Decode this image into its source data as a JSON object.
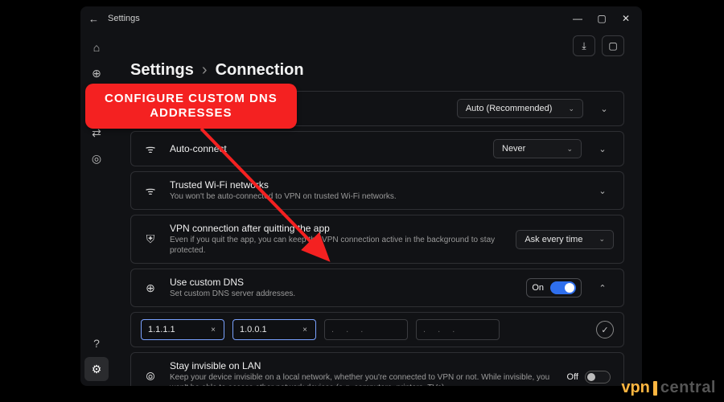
{
  "annotation": {
    "text_line1": "CONFIGURE CUSTOM DNS",
    "text_line2": "ADDRESSES",
    "color": "#f42121"
  },
  "window": {
    "back_label": "Settings",
    "winctrls": {
      "min": "—",
      "max": "▢",
      "close": "✕"
    }
  },
  "sidebar": {
    "items": [
      {
        "name": "home-icon",
        "glyph": "⌂"
      },
      {
        "name": "globe-icon",
        "glyph": "⊕"
      },
      {
        "name": "shuffle-icon",
        "glyph": "⇄"
      },
      {
        "name": "target-icon",
        "glyph": "◎"
      }
    ],
    "bottom": [
      {
        "name": "help-icon",
        "glyph": "?"
      },
      {
        "name": "gear-icon",
        "glyph": "⚙",
        "active": true
      }
    ]
  },
  "topactions": {
    "download": "⤓",
    "bell": "▢"
  },
  "breadcrumb": {
    "root": "Settings",
    "sep": "›",
    "page": "Connection"
  },
  "rows": {
    "protocol": {
      "value": "Auto (Recommended)"
    },
    "autoconnect": {
      "title": "Auto-connect",
      "value": "Never"
    },
    "trusted": {
      "title": "Trusted Wi-Fi networks",
      "desc": "You won't be auto-connected to VPN on trusted Wi-Fi networks."
    },
    "afterquit": {
      "title": "VPN connection after quitting the app",
      "desc": "Even if you quit the app, you can keep the VPN connection active in the background to stay protected.",
      "value": "Ask every time"
    },
    "customdns": {
      "title": "Use custom DNS",
      "desc": "Set custom DNS server addresses.",
      "state": "On"
    },
    "dnsfields": {
      "dns1": "1.1.1.1",
      "dns2": "1.0.0.1",
      "empty": ".   .   .",
      "clear": "×",
      "confirm": "✓"
    },
    "lan": {
      "title": "Stay invisible on LAN",
      "desc": "Keep your device invisible on a local network, whether you're connected to VPN or not. While invisible, you won't be able to access other network devices (e.g. computers, printers, TVs).",
      "state": "Off"
    }
  },
  "watermark": {
    "vpn": "vpn",
    "central": "central"
  }
}
